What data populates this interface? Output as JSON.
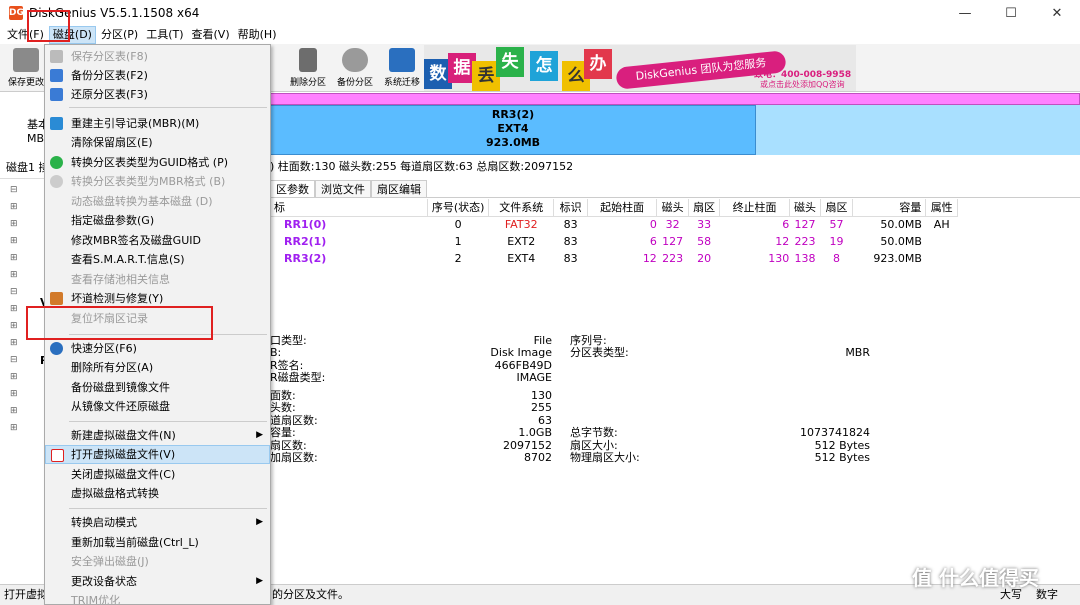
{
  "window": {
    "title": "DiskGenius V5.5.1.1508 x64",
    "icon": "DG"
  },
  "menubar": [
    "文件(F)",
    "磁盘(D)",
    "分区(P)",
    "工具(T)",
    "查看(V)",
    "帮助(H)"
  ],
  "toolbar": {
    "save": "保存更改",
    "delete": "删除分区",
    "backup": "备份分区",
    "migrate": "系统迁移"
  },
  "banner": {
    "tiles": [
      "数",
      "据",
      "丢",
      "失",
      "怎",
      "么",
      "办"
    ],
    "slogan": "DiskGenius 团队为您服务",
    "phone": "致电：400-008-9958",
    "qq": "或点击此处添加QQ咨询"
  },
  "diskbar": {
    "name": "RR3(2)",
    "fs": "EXT4",
    "size": "923.0MB"
  },
  "left_panel": {
    "basic": "基本",
    "mbr": "MB",
    "disk_label": "磁盘1 接",
    "tree_v": "V",
    "tree_r": "R"
  },
  "infostrip": ") 柱面数:130 磁头数:255 每道扇区数:63 总扇区数:2097152",
  "tabs": [
    "区参数",
    "浏览文件",
    "扇区编辑"
  ],
  "partition_table": {
    "headers": [
      "标",
      "序号(状态)",
      "文件系统",
      "标识",
      "起始柱面",
      "磁头",
      "扇区",
      "终止柱面",
      "磁头",
      "扇区",
      "容量",
      "属性"
    ],
    "rows": [
      {
        "name": "RR1(0)",
        "seq": "0",
        "fs": "FAT32",
        "id": "83",
        "sc": "0",
        "sh": "32",
        "ss": "33",
        "ec": "6",
        "eh": "127",
        "es": "57",
        "cap": "50.0MB",
        "attr": "AH"
      },
      {
        "name": "RR2(1)",
        "seq": "1",
        "fs": "EXT2",
        "id": "83",
        "sc": "6",
        "sh": "127",
        "ss": "58",
        "ec": "12",
        "eh": "223",
        "es": "19",
        "cap": "50.0MB",
        "attr": ""
      },
      {
        "name": "RR3(2)",
        "seq": "2",
        "fs": "EXT4",
        "id": "83",
        "sc": "12",
        "sh": "223",
        "ss": "20",
        "ec": "130",
        "eh": "138",
        "es": "8",
        "cap": "923.0MB",
        "attr": ""
      }
    ]
  },
  "details": {
    "labels_left": [
      "口类型:",
      "B:",
      "R签名:",
      "R磁盘类型:",
      "面数:",
      "头数:",
      "道扇区数:",
      "容量:",
      "扇区数:",
      "加扇区数:"
    ],
    "values_left": [
      "File",
      "Disk Image",
      "466FB49D",
      "IMAGE",
      "130",
      "255",
      "63",
      "1.0GB",
      "2097152",
      "8702"
    ],
    "labels_right": [
      "序列号:",
      "分区表类型:",
      "总字节数:",
      "扇区大小:",
      "物理扇区大小:"
    ],
    "values_right": [
      "MBR",
      "1073741824",
      "512 Bytes",
      "512 Bytes"
    ]
  },
  "menu": {
    "items": [
      {
        "label": "保存分区表(F8)",
        "disabled": true
      },
      {
        "label": "备份分区表(F2)",
        "disabled": false
      },
      {
        "label": "还原分区表(F3)",
        "disabled": false
      },
      {
        "label": "重建主引导记录(MBR)(M)",
        "disabled": false
      },
      {
        "label": "清除保留扇区(E)",
        "disabled": false
      },
      {
        "label": "转换分区表类型为GUID格式 (P)",
        "disabled": false
      },
      {
        "label": "转换分区表类型为MBR格式 (B)",
        "disabled": true
      },
      {
        "label": "动态磁盘转换为基本磁盘 (D)",
        "disabled": true
      },
      {
        "label": "指定磁盘参数(G)",
        "disabled": false
      },
      {
        "label": "修改MBR签名及磁盘GUID",
        "disabled": false
      },
      {
        "label": "查看S.M.A.R.T.信息(S)",
        "disabled": false
      },
      {
        "label": "查看存储池相关信息",
        "disabled": true
      },
      {
        "label": "坏道检测与修复(Y)",
        "disabled": false
      },
      {
        "label": "复位坏扇区记录",
        "disabled": true
      },
      {
        "label": "快速分区(F6)",
        "disabled": false
      },
      {
        "label": "删除所有分区(A)",
        "disabled": false
      },
      {
        "label": "备份磁盘到镜像文件",
        "disabled": false
      },
      {
        "label": "从镜像文件还原磁盘",
        "disabled": false
      },
      {
        "label": "新建虚拟磁盘文件(N)",
        "disabled": false
      },
      {
        "label": "打开虚拟磁盘文件(V)",
        "disabled": false
      },
      {
        "label": "关闭虚拟磁盘文件(C)",
        "disabled": false
      },
      {
        "label": "虚拟磁盘格式转换",
        "disabled": false
      },
      {
        "label": "转换启动模式",
        "disabled": false
      },
      {
        "label": "重新加载当前磁盘(Ctrl_L)",
        "disabled": false
      },
      {
        "label": "安全弹出磁盘(J)",
        "disabled": true
      },
      {
        "label": "更改设备状态",
        "disabled": false
      },
      {
        "label": "TRIM优化",
        "disabled": true
      }
    ]
  },
  "statusbar": {
    "left": "打开虚拟",
    "mid": "的分区及文件。",
    "caps": "大写",
    "num": "数字"
  },
  "watermark": "值 什么值得买",
  "colors": {
    "accent": "#cce4f7",
    "highlight_box": "#e02020",
    "partition_bar": "#5bbcff",
    "pink": "#ff80ff",
    "rr_name": "#a020f0",
    "red_fs": "#e02020"
  }
}
